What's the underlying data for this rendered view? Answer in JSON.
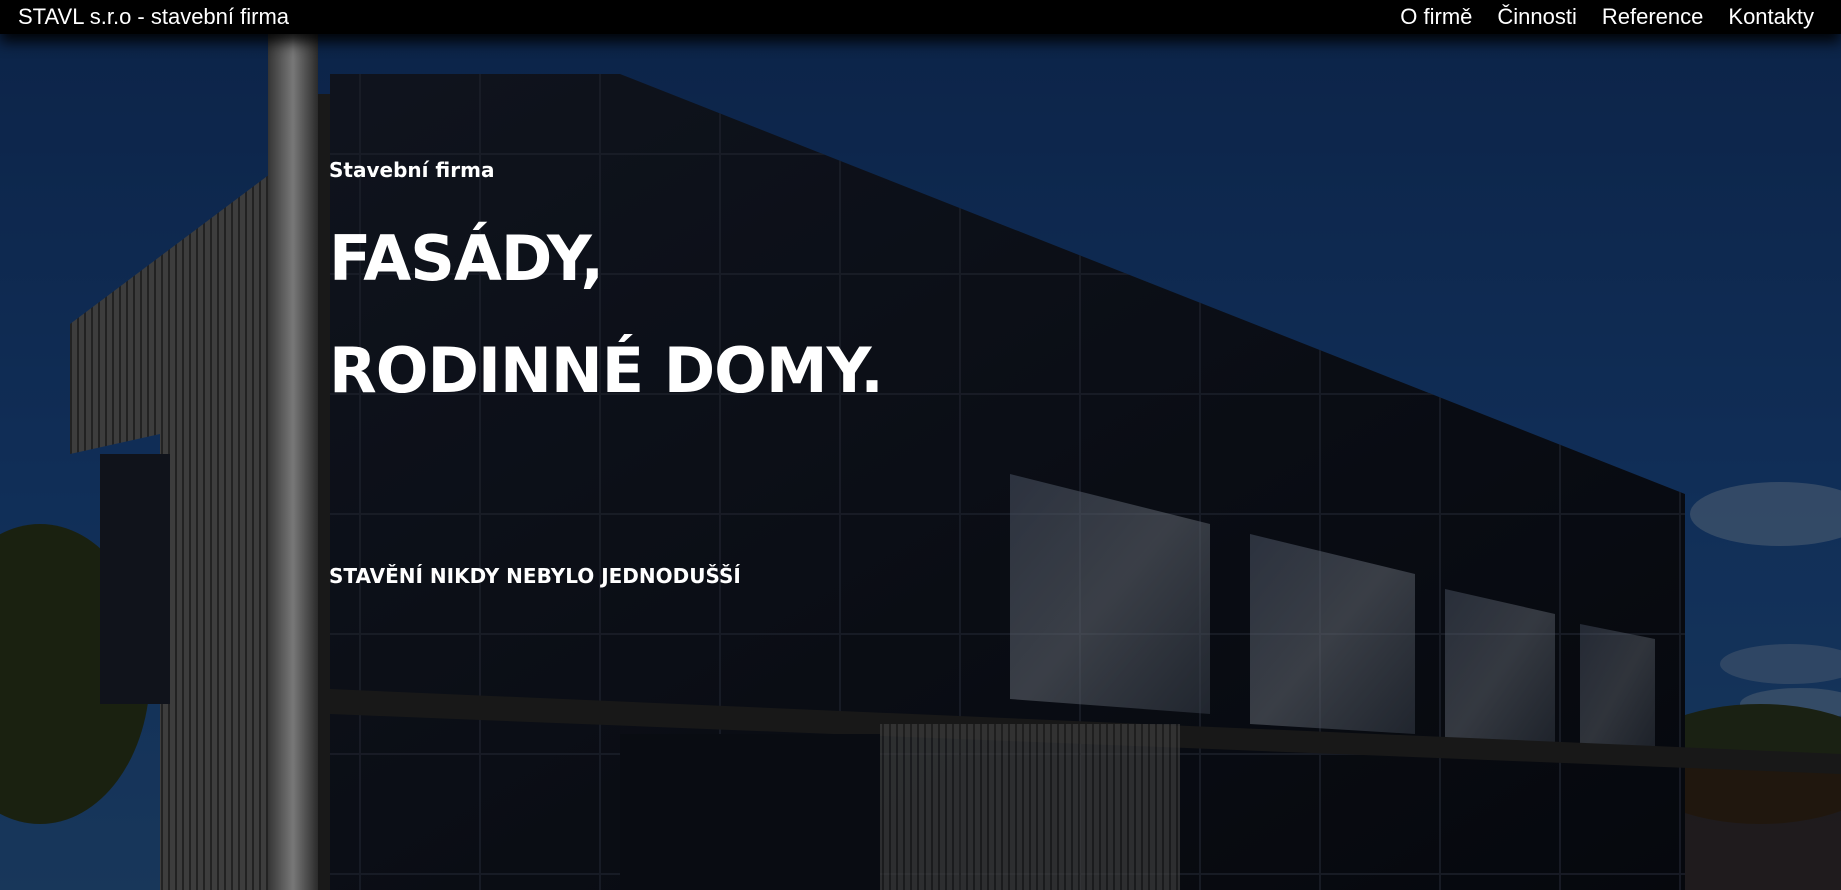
{
  "navbar": {
    "brand": "STAVL s.r.o - stavební firma",
    "links": [
      "O firmě",
      "Činnosti",
      "Reference",
      "Kontakty"
    ]
  },
  "hero": {
    "label": "Stavební firma",
    "headline_line1": "FASÁDY,",
    "headline_line2": "RODINNÉ DOMY.",
    "tagline": "STAVĚNÍ NIKDY NEBYLO JEDNODUŠŠÍ",
    "background_image": "building-with-black-glass-facade-photo"
  },
  "colors": {
    "navbar_bg": "#000000",
    "text": "#ffffff",
    "sky": "#1c4f96"
  }
}
